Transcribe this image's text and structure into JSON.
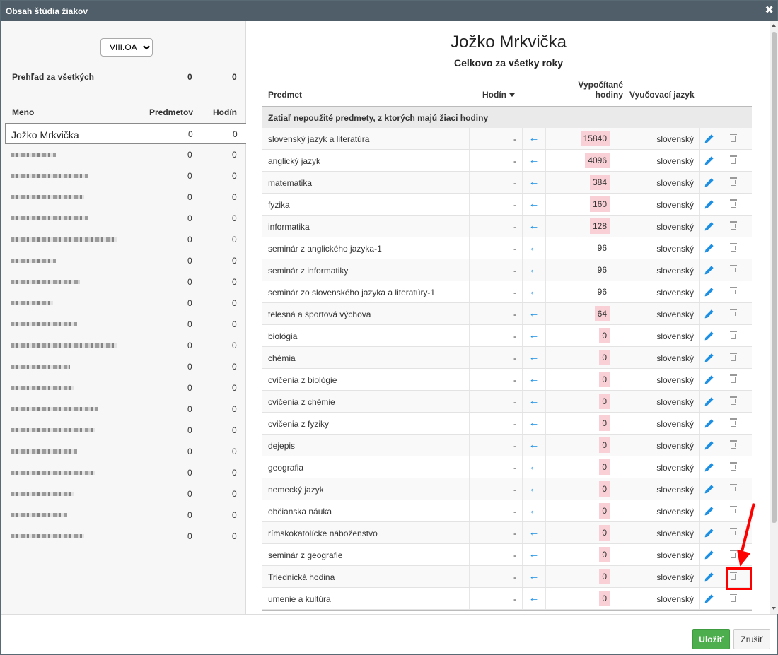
{
  "dialog": {
    "title": "Obsah štúdia žiakov",
    "close_icon": "close-icon"
  },
  "left": {
    "class_select": {
      "selected": "VIII.OA",
      "options": [
        "VIII.OA"
      ]
    },
    "overview": {
      "label": "Prehľad za všetkých",
      "subjects": "0",
      "hours": "0"
    },
    "headers": {
      "name": "Meno",
      "subjects": "Predmetov",
      "hours": "Hodín"
    },
    "students": [
      {
        "name": "Jožko Mrkvička",
        "subjects": "0",
        "hours": "0",
        "selected": true
      },
      {
        "name": "",
        "subjects": "0",
        "hours": "0",
        "redacted": true,
        "blur_width": 0.32
      },
      {
        "name": "",
        "subjects": "0",
        "hours": "0",
        "redacted": true,
        "blur_width": 0.55
      },
      {
        "name": "",
        "subjects": "0",
        "hours": "0",
        "redacted": true,
        "blur_width": 0.52
      },
      {
        "name": "",
        "subjects": "0",
        "hours": "0",
        "redacted": true,
        "blur_width": 0.55
      },
      {
        "name": "",
        "subjects": "0",
        "hours": "0",
        "redacted": true,
        "blur_width": 0.75
      },
      {
        "name": "",
        "subjects": "0",
        "hours": "0",
        "redacted": true,
        "blur_width": 0.32
      },
      {
        "name": "",
        "subjects": "0",
        "hours": "0",
        "redacted": true,
        "blur_width": 0.49
      },
      {
        "name": "",
        "subjects": "0",
        "hours": "0",
        "redacted": true,
        "blur_width": 0.3
      },
      {
        "name": "",
        "subjects": "0",
        "hours": "0",
        "redacted": true,
        "blur_width": 0.47
      },
      {
        "name": "",
        "subjects": "0",
        "hours": "0",
        "redacted": true,
        "blur_width": 0.75
      },
      {
        "name": "",
        "subjects": "0",
        "hours": "0",
        "redacted": true,
        "blur_width": 0.42
      },
      {
        "name": "",
        "subjects": "0",
        "hours": "0",
        "redacted": true,
        "blur_width": 0.45
      },
      {
        "name": "",
        "subjects": "0",
        "hours": "0",
        "redacted": true,
        "blur_width": 0.62
      },
      {
        "name": "",
        "subjects": "0",
        "hours": "0",
        "redacted": true,
        "blur_width": 0.6
      },
      {
        "name": "",
        "subjects": "0",
        "hours": "0",
        "redacted": true,
        "blur_width": 0.47
      },
      {
        "name": "",
        "subjects": "0",
        "hours": "0",
        "redacted": true,
        "blur_width": 0.6
      },
      {
        "name": "",
        "subjects": "0",
        "hours": "0",
        "redacted": true,
        "blur_width": 0.45
      },
      {
        "name": "",
        "subjects": "0",
        "hours": "0",
        "redacted": true,
        "blur_width": 0.4
      },
      {
        "name": "",
        "subjects": "0",
        "hours": "0",
        "redacted": true,
        "blur_width": 0.52
      }
    ]
  },
  "main": {
    "student_name": "Jožko Mrkvička",
    "subtitle": "Celkovo za všetky roky",
    "headers": {
      "subject": "Predmet",
      "hours": "Hodín",
      "calculated": "Vypočítané hodiny",
      "language": "Vyučovací jazyk"
    },
    "group_label": "Zatiaľ nepoužité predmety, z ktorých majú žiaci hodiny",
    "arrow_glyph": "←",
    "rows": [
      {
        "subject": "slovenský jazyk a literatúra",
        "hours": "-",
        "calculated": "15840",
        "warn": true,
        "language": "slovenský"
      },
      {
        "subject": "anglický jazyk",
        "hours": "-",
        "calculated": "4096",
        "warn": true,
        "language": "slovenský"
      },
      {
        "subject": "matematika",
        "hours": "-",
        "calculated": "384",
        "warn": true,
        "language": "slovenský"
      },
      {
        "subject": "fyzika",
        "hours": "-",
        "calculated": "160",
        "warn": true,
        "language": "slovenský"
      },
      {
        "subject": "informatika",
        "hours": "-",
        "calculated": "128",
        "warn": true,
        "language": "slovenský"
      },
      {
        "subject": "seminár z anglického jazyka-1",
        "hours": "-",
        "calculated": "96",
        "warn": false,
        "language": "slovenský"
      },
      {
        "subject": "seminár z informatiky",
        "hours": "-",
        "calculated": "96",
        "warn": false,
        "language": "slovenský"
      },
      {
        "subject": "seminár zo slovenského jazyka a literatúry-1",
        "hours": "-",
        "calculated": "96",
        "warn": false,
        "language": "slovenský"
      },
      {
        "subject": "telesná a športová výchova",
        "hours": "-",
        "calculated": "64",
        "warn": true,
        "language": "slovenský"
      },
      {
        "subject": "biológia",
        "hours": "-",
        "calculated": "0",
        "warn": true,
        "language": "slovenský"
      },
      {
        "subject": "chémia",
        "hours": "-",
        "calculated": "0",
        "warn": true,
        "language": "slovenský"
      },
      {
        "subject": "cvičenia z biológie",
        "hours": "-",
        "calculated": "0",
        "warn": true,
        "language": "slovenský"
      },
      {
        "subject": "cvičenia z chémie",
        "hours": "-",
        "calculated": "0",
        "warn": true,
        "language": "slovenský"
      },
      {
        "subject": "cvičenia z fyziky",
        "hours": "-",
        "calculated": "0",
        "warn": true,
        "language": "slovenský"
      },
      {
        "subject": "dejepis",
        "hours": "-",
        "calculated": "0",
        "warn": true,
        "language": "slovenský"
      },
      {
        "subject": "geografia",
        "hours": "-",
        "calculated": "0",
        "warn": true,
        "language": "slovenský"
      },
      {
        "subject": "nemecký jazyk",
        "hours": "-",
        "calculated": "0",
        "warn": true,
        "language": "slovenský"
      },
      {
        "subject": "občianska náuka",
        "hours": "-",
        "calculated": "0",
        "warn": true,
        "language": "slovenský"
      },
      {
        "subject": "rímskokatolícke náboženstvo",
        "hours": "-",
        "calculated": "0",
        "warn": true,
        "language": "slovenský"
      },
      {
        "subject": "seminár z geografie",
        "hours": "-",
        "calculated": "0",
        "warn": true,
        "language": "slovenský"
      },
      {
        "subject": "Triednická hodina",
        "hours": "-",
        "calculated": "0",
        "warn": true,
        "language": "slovenský",
        "highlighted": true
      },
      {
        "subject": "umenie a kultúra",
        "hours": "-",
        "calculated": "0",
        "warn": true,
        "language": "slovenský"
      }
    ]
  },
  "footer": {
    "save_label": "Uložiť",
    "cancel_label": "Zrušiť"
  },
  "colors": {
    "titlebar": "#4f5e68",
    "accent_blue": "#1a8fe3",
    "warn_bg": "#f8d0d5",
    "save_green": "#4cae4c",
    "annotation_red": "#ff0000"
  }
}
